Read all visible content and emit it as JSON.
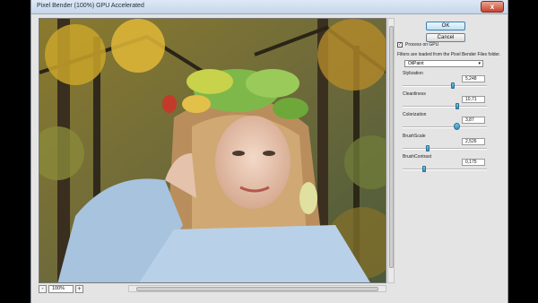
{
  "window": {
    "title": "Pixel Bender (100%) GPU Accelerated",
    "close_symbol": "x"
  },
  "buttons": {
    "ok": "OK",
    "cancel": "Cancel"
  },
  "gpu": {
    "label": "Process on GPU",
    "checked": true,
    "check_mark": "✓"
  },
  "folder_note": "Filters are loaded from the Pixel Bender Files folder.",
  "filter": {
    "selected": "OilPaint"
  },
  "params": [
    {
      "label": "Stylization",
      "value": "5,248",
      "fraction": 0.6
    },
    {
      "label": "Cleanliness",
      "value": "10,71",
      "fraction": 0.65
    },
    {
      "label": "Colorization",
      "value": "3,87",
      "fraction": 0.64
    },
    {
      "label": "BrushScale",
      "value": "2,526",
      "fraction": 0.3
    },
    {
      "label": "BrushContrast",
      "value": "0,175",
      "fraction": 0.25
    }
  ],
  "zoom": {
    "minus": "-",
    "value": "100%",
    "plus": "+"
  },
  "colors": {
    "accent": "#2a8fc0",
    "window_bg": "#e4e4e4"
  }
}
